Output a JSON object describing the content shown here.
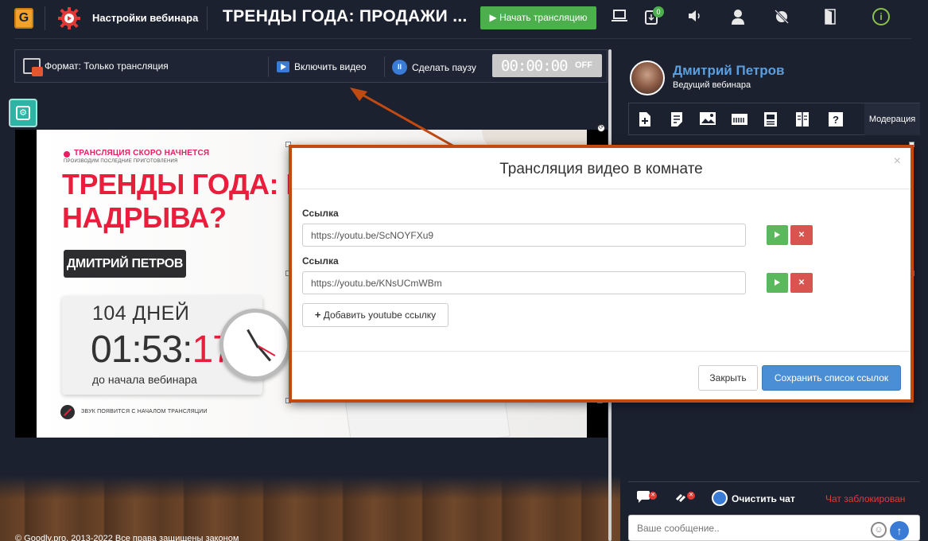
{
  "header": {
    "logo_letter": "G",
    "settings_title": "Настройки вебинара",
    "webinar_title": "ТРЕНДЫ ГОДА: ПРОДАЖИ ...",
    "start_label": "Начать трансляцию",
    "badge_count": "0",
    "icons": [
      "gear-red-icon",
      "laptop-icon",
      "download-badge-icon",
      "volume-icon",
      "user-icon",
      "no-effects-icon",
      "door-icon",
      "info-icon"
    ]
  },
  "controls": {
    "format_label": "Формат: Только трансляция",
    "enable_video_label": "Включить видео",
    "pause_label": "Сделать паузу",
    "timer_value": "00:00:00",
    "timer_state": "OFF"
  },
  "slide": {
    "status": "ТРАНСЛЯЦИЯ СКОРО НАЧНЕТСЯ",
    "sub_status": "ПРОИЗВОДИМ ПОСЛЕДНИЕ ПРИГОТОВЛЕНИЯ",
    "title_line1": "ТРЕНДЫ ГОДА: ПРОД",
    "title_line2": "НАДРЫВА?",
    "speaker": "ДМИТРИЙ ПЕТРОВ",
    "days": "104 ДНЕЙ",
    "time_main": "01:53:",
    "time_sec": "17",
    "until": "до начала вебинара",
    "sound_note": "ЗВУК ПОЯВИТСЯ С НАЧАЛОМ ТРАНСЛЯЦИИ"
  },
  "footer": {
    "copyright": "© Goodly.pro, 2013-2022 Все права защищены законом"
  },
  "host": {
    "name": "Дмитрий Петров",
    "role": "Ведущий вебинара"
  },
  "tools": {
    "items": [
      "add-file-icon",
      "document-icon",
      "image-icon",
      "timer-icon",
      "presentation-icon",
      "book-icon",
      "question-icon"
    ],
    "moderation_label": "Модерация"
  },
  "chat": {
    "clear_label": "Очистить чат",
    "blocked_label": "Чат заблокирован",
    "message_placeholder": "Ваше сообщение.."
  },
  "modal": {
    "title": "Трансляция видео в комнате",
    "close_glyph": "×",
    "links": [
      {
        "label": "Ссылка",
        "value": "https://youtu.be/ScNOYFXu9"
      },
      {
        "label": "Ссылка",
        "value": "https://youtu.be/KNsUCmWBm"
      }
    ],
    "add_label": "Добавить youtube ссылку",
    "close_label": "Закрыть",
    "save_label": "Сохранить список ссылок"
  },
  "colors": {
    "accent_green": "#4cae4c",
    "highlight_orange": "#c04a11",
    "slide_red": "#e91e3c",
    "primary_blue": "#4a8fd6"
  }
}
